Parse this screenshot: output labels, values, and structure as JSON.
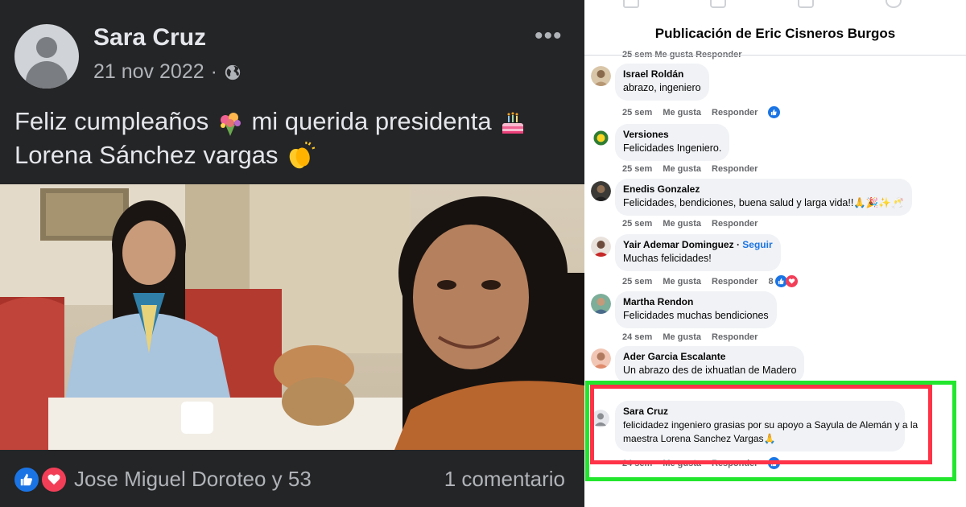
{
  "post": {
    "author": "Sara Cruz",
    "date": "21 nov 2022",
    "separator": "·",
    "more_label": "•••",
    "text_line1": "Feliz cumpleaños",
    "text_line1b": "mi querida presidenta",
    "text_line2": "Lorena Sánchez vargas",
    "reactors": "Jose Miguel Doroteo y 53",
    "comment_count": "1 comentario"
  },
  "comments_panel": {
    "title": "Publicación de Eric Cisneros Burgos",
    "clipped_actions": "25 sem    Me gusta    Responder",
    "comments": [
      {
        "name": "Israel Roldán",
        "text": "abrazo, ingeniero",
        "time": "25 sem",
        "like": "Me gusta",
        "reply": "Responder",
        "reactions": ""
      },
      {
        "name": "Versiones",
        "text": "Felicidades Ingeniero.",
        "time": "25 sem",
        "like": "Me gusta",
        "reply": "Responder",
        "reactions": ""
      },
      {
        "name": "Enedis Gonzalez",
        "text": "Felicidades, bendiciones, buena salud y larga vida!!🙏🎉✨🥂",
        "time": "25 sem",
        "like": "Me gusta",
        "reply": "Responder",
        "reactions": ""
      },
      {
        "name": "Yair Ademar Dominguez",
        "follow": "Seguir",
        "text": "Muchas felicidades!",
        "time": "25 sem",
        "like": "Me gusta",
        "reply": "Responder",
        "reactions": "8"
      },
      {
        "name": "Martha Rendon",
        "text": "Felicidades muchas bendiciones",
        "time": "24 sem",
        "like": "Me gusta",
        "reply": "Responder",
        "reactions": ""
      },
      {
        "name": "Ader Garcia Escalante",
        "text": "Un abrazo des de ixhuatlan de Madero",
        "time": "",
        "like": "",
        "reply": "",
        "reactions": ""
      },
      {
        "name": "Sara Cruz",
        "text_line1": "felicidadez ingeniero grasias por su apoyo a Sayula de Alemán y a la",
        "text_line2": "maestra Lorena Sanchez Vargas🙏",
        "time": "24 sem",
        "like": "Me gusta",
        "reply": "Responder",
        "reactions": ""
      }
    ]
  },
  "colors": {
    "dark_bg": "#242526",
    "like_blue": "#1b74e4",
    "love_red": "#f33e58",
    "highlight_green": "#22e62e",
    "highlight_red": "#ff3348"
  },
  "icons": [
    "globe-icon",
    "more-options-icon",
    "bouquet-emoji",
    "cake-emoji",
    "clapping-hands-emoji",
    "like-reaction-icon",
    "love-reaction-icon",
    "default-avatar-icon"
  ]
}
